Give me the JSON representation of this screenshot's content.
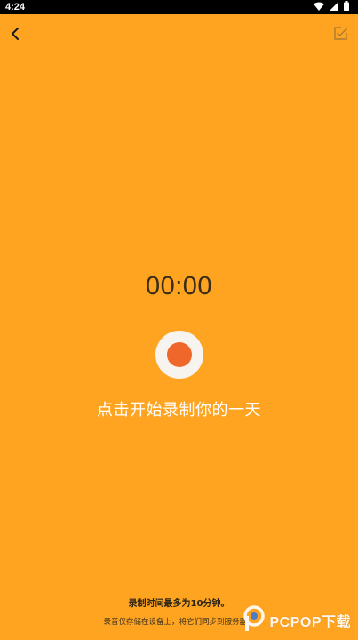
{
  "status_bar": {
    "time": "4:24",
    "icons": [
      "wifi-icon",
      "signal-icon",
      "battery-icon"
    ]
  },
  "toolbar": {
    "back_icon": "chevron-left-icon",
    "edit_icon": "edit-square-icon"
  },
  "recorder": {
    "timer": "00:00",
    "record_icon": "record-icon",
    "prompt": "点击开始录制你的一天"
  },
  "footer": {
    "limit_note": "录制时间最多为10分钟。",
    "storage_note": "录音仅存储在设备上，将它们同步到服务器。"
  },
  "watermark": {
    "text": "PCPOP下载"
  },
  "colors": {
    "background": "#FFA421",
    "record_outer": "#F7F3EE",
    "record_dot": "#F0672C"
  }
}
